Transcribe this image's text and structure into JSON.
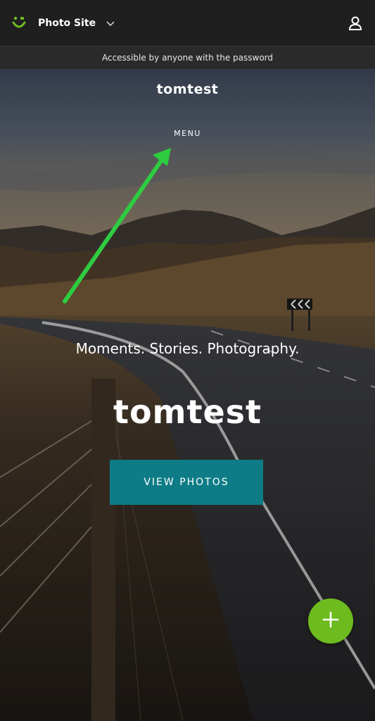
{
  "topbar": {
    "site_name": "Photo Site",
    "logo_icon": "smugmug-smile-icon",
    "chevron_icon": "chevron-down-icon",
    "user_icon": "user-icon",
    "brand_color": "#6dbb1e"
  },
  "access_banner": {
    "text": "Accessible by anyone with the password"
  },
  "hero": {
    "site_title": "tomtest",
    "menu_label": "MENU",
    "tagline": "Moments. Stories. Photography.",
    "big_title": "tomtest",
    "view_button_label": "VIEW PHOTOS",
    "view_button_color": "#0e7c86",
    "annotation_color": "#2ecc40"
  },
  "fab": {
    "icon": "plus-icon",
    "color": "#6dbb1e"
  }
}
